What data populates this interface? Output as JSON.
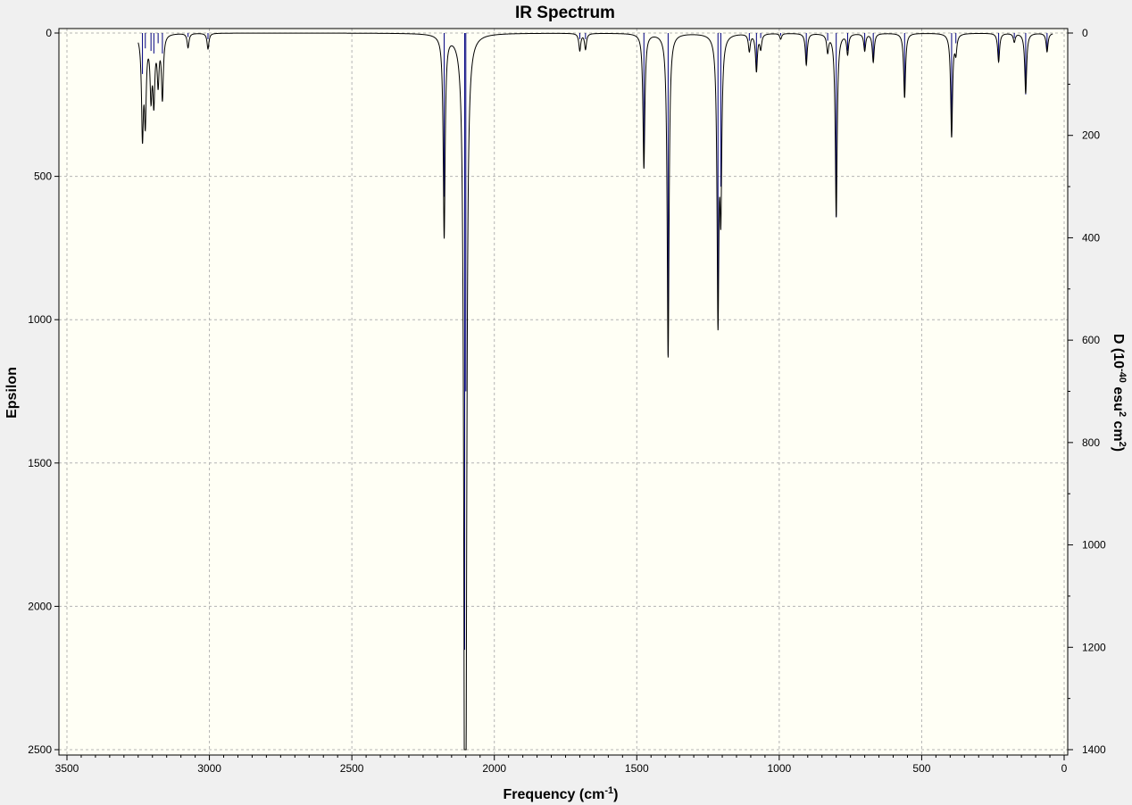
{
  "chart_data": {
    "type": "line",
    "title": "IR Spectrum",
    "xlabel": {
      "main": "Frequency (cm",
      "sup": "-1",
      "close": ")"
    },
    "ylabel_left": "Epsilon",
    "ylabel_right": {
      "a": "D (10",
      "sup1": "-40",
      "b": " esu",
      "sup2": "2",
      "c": " cm",
      "sup3": "2",
      "d": ")"
    },
    "xlim": [
      3500,
      0
    ],
    "ylim_left": [
      0,
      2500
    ],
    "ylim_right": [
      0,
      1400
    ],
    "x_ticks": [
      "3500",
      "3000",
      "2500",
      "2000",
      "1500",
      "1000",
      "500",
      "0"
    ],
    "y_left_ticks": [
      "0",
      "500",
      "1000",
      "1500",
      "2000",
      "2500"
    ],
    "y_right_ticks": [
      "0",
      "200",
      "400",
      "600",
      "800",
      "1000",
      "1200",
      "1400"
    ],
    "grid": true,
    "x_range_drawn": [
      3250,
      40
    ],
    "peaks": [
      {
        "x": 3235,
        "epsilon": 340,
        "d": 80
      },
      {
        "x": 3225,
        "epsilon": 280,
        "d": 30
      },
      {
        "x": 3205,
        "epsilon": 200,
        "d": 35
      },
      {
        "x": 3195,
        "epsilon": 220,
        "d": 40
      },
      {
        "x": 3180,
        "epsilon": 160,
        "d": 20
      },
      {
        "x": 3165,
        "epsilon": 220,
        "d": 40
      },
      {
        "x": 3075,
        "epsilon": 50,
        "d": 8
      },
      {
        "x": 3005,
        "epsilon": 55,
        "d": 12
      },
      {
        "x": 2176,
        "epsilon": 705,
        "d": 320
      },
      {
        "x": 2104,
        "epsilon": 2150,
        "d": 1205
      },
      {
        "x": 2100,
        "epsilon": 1900,
        "d": 700
      },
      {
        "x": 1700,
        "epsilon": 60,
        "d": 12
      },
      {
        "x": 1680,
        "epsilon": 55,
        "d": 12
      },
      {
        "x": 1475,
        "epsilon": 470,
        "d": 245
      },
      {
        "x": 1390,
        "epsilon": 1130,
        "d": 630
      },
      {
        "x": 1215,
        "epsilon": 960,
        "d": 540
      },
      {
        "x": 1205,
        "epsilon": 550,
        "d": 300
      },
      {
        "x": 1105,
        "epsilon": 60,
        "d": 15
      },
      {
        "x": 1080,
        "epsilon": 130,
        "d": 70
      },
      {
        "x": 1065,
        "epsilon": 50,
        "d": 10
      },
      {
        "x": 995,
        "epsilon": 20,
        "d": 5
      },
      {
        "x": 905,
        "epsilon": 110,
        "d": 60
      },
      {
        "x": 830,
        "epsilon": 60,
        "d": 15
      },
      {
        "x": 800,
        "epsilon": 640,
        "d": 360
      },
      {
        "x": 760,
        "epsilon": 70,
        "d": 35
      },
      {
        "x": 700,
        "epsilon": 60,
        "d": 30
      },
      {
        "x": 670,
        "epsilon": 100,
        "d": 55
      },
      {
        "x": 560,
        "epsilon": 225,
        "d": 125
      },
      {
        "x": 395,
        "epsilon": 360,
        "d": 200
      },
      {
        "x": 380,
        "epsilon": 60,
        "d": 20
      },
      {
        "x": 230,
        "epsilon": 100,
        "d": 55
      },
      {
        "x": 175,
        "epsilon": 30,
        "d": 10
      },
      {
        "x": 135,
        "epsilon": 210,
        "d": 120
      },
      {
        "x": 60,
        "epsilon": 65,
        "d": 35
      }
    ],
    "colors": {
      "background": "#f0f0f0",
      "plot_area": "#fffff5",
      "spectrum": "#000000",
      "sticks": "#000080",
      "grid": "#b4b4b4",
      "axis": "#000000"
    }
  }
}
